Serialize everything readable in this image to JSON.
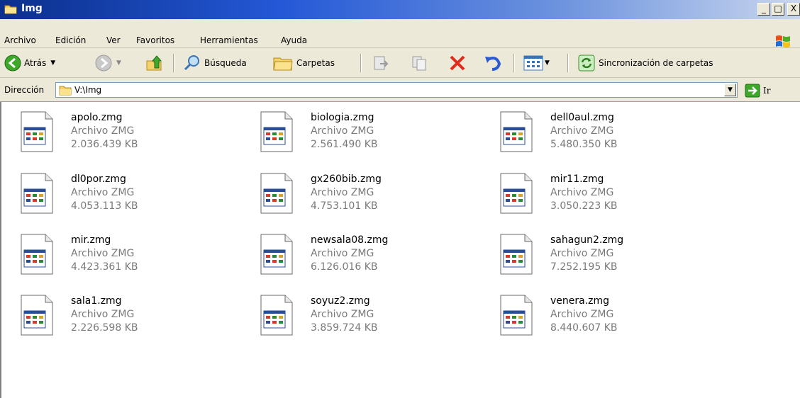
{
  "window": {
    "title": "Img",
    "buttons": {
      "minimize": "_",
      "maximize": "□",
      "close": "X"
    }
  },
  "menu": {
    "items": [
      "Archivo",
      "Edición",
      "Ver",
      "Favoritos",
      "Herramientas",
      "Ayuda"
    ]
  },
  "toolbar": {
    "back_label": "Atrás",
    "search_label": "Búsqueda",
    "folders_label": "Carpetas",
    "sync_label": "Sincronización de carpetas"
  },
  "address": {
    "label": "Dirección",
    "value": "V:\\Img",
    "go_label": "Ir"
  },
  "files": [
    {
      "name": "apolo.zmg",
      "type": "Archivo ZMG",
      "size": "2.036.439 KB"
    },
    {
      "name": "biologia.zmg",
      "type": "Archivo ZMG",
      "size": "2.561.490 KB"
    },
    {
      "name": "dell0aul.zmg",
      "type": "Archivo ZMG",
      "size": "5.480.350 KB"
    },
    {
      "name": "dl0por.zmg",
      "type": "Archivo ZMG",
      "size": "4.053.113 KB"
    },
    {
      "name": "gx260bib.zmg",
      "type": "Archivo ZMG",
      "size": "4.753.101 KB"
    },
    {
      "name": "mir11.zmg",
      "type": "Archivo ZMG",
      "size": "3.050.223 KB"
    },
    {
      "name": "mir.zmg",
      "type": "Archivo ZMG",
      "size": "4.423.361 KB"
    },
    {
      "name": "newsala08.zmg",
      "type": "Archivo ZMG",
      "size": "6.126.016 KB"
    },
    {
      "name": "sahagun2.zmg",
      "type": "Archivo ZMG",
      "size": "7.252.195 KB"
    },
    {
      "name": "sala1.zmg",
      "type": "Archivo ZMG",
      "size": "2.226.598 KB"
    },
    {
      "name": "soyuz2.zmg",
      "type": "Archivo ZMG",
      "size": "3.859.724 KB"
    },
    {
      "name": "venera.zmg",
      "type": "Archivo ZMG",
      "size": "8.440.607 KB"
    }
  ],
  "colors": {
    "titlebar": "#2458d6",
    "chrome": "#ece9d8",
    "meta_text": "#7a7a7a"
  }
}
